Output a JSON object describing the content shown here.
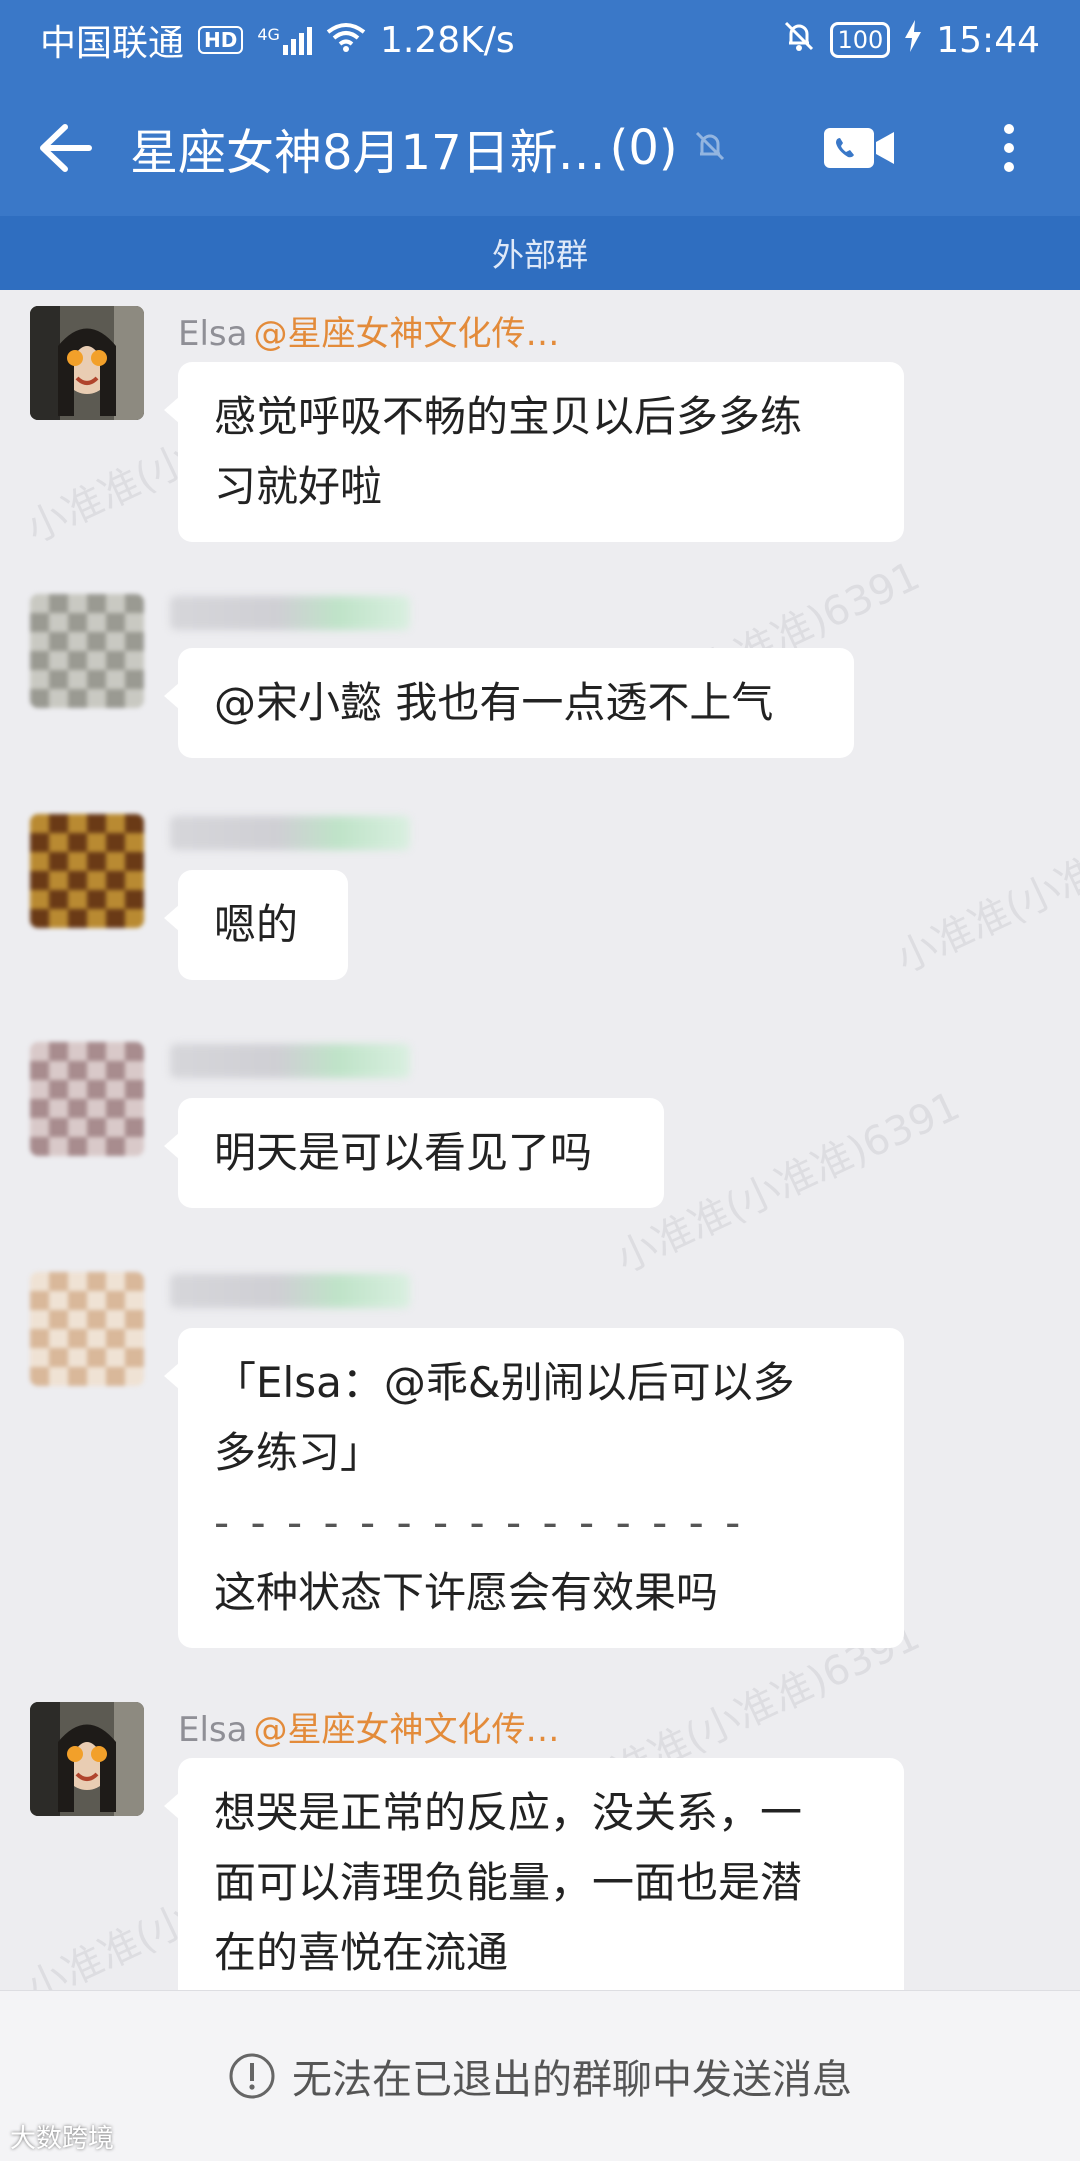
{
  "status_bar": {
    "carrier": "中国联通",
    "hd": "HD",
    "network": "4G",
    "speed": "1.28K/s",
    "battery": "100",
    "time": "15:44"
  },
  "app_bar": {
    "title": "星座女神8月17日新…",
    "member_count": "(0)",
    "icons": [
      "back-arrow-icon",
      "mute-bell-icon",
      "video-call-icon",
      "more-vertical-icon"
    ]
  },
  "group_tag": "外部群",
  "messages": [
    {
      "sender": "Elsa",
      "mention": "@星座女神文化传…",
      "lines": [
        "感觉呼吸不畅的宝贝以后多多练",
        "习就好啦"
      ]
    },
    {
      "sender": "",
      "lines": [
        "@宋小懿 我也有一点透不上气"
      ]
    },
    {
      "sender": "",
      "lines": [
        "嗯的"
      ]
    },
    {
      "sender": "",
      "lines": [
        "明天是可以看见了吗"
      ]
    },
    {
      "sender": "",
      "lines": [
        "「Elsa：@乖&别闹以后可以多",
        "多练习」",
        "- - - - - - - - - - - - - - -",
        "这种状态下许愿会有效果吗"
      ]
    },
    {
      "sender": "Elsa",
      "mention": "@星座女神文化传…",
      "lines": [
        "想哭是正常的反应，没关系，一",
        "面可以清理负能量，一面也是潜",
        "在的喜悦在流通"
      ]
    }
  ],
  "watermark": "小准准(小准准)6391",
  "notice": "无法在已退出的群聊中发送消息",
  "corner_logo": "大数跨境",
  "colors": {
    "header": "#3a78c8",
    "header_strip": "#2f6ec0",
    "mention": "#e38b3a",
    "background": "#ededf0"
  }
}
